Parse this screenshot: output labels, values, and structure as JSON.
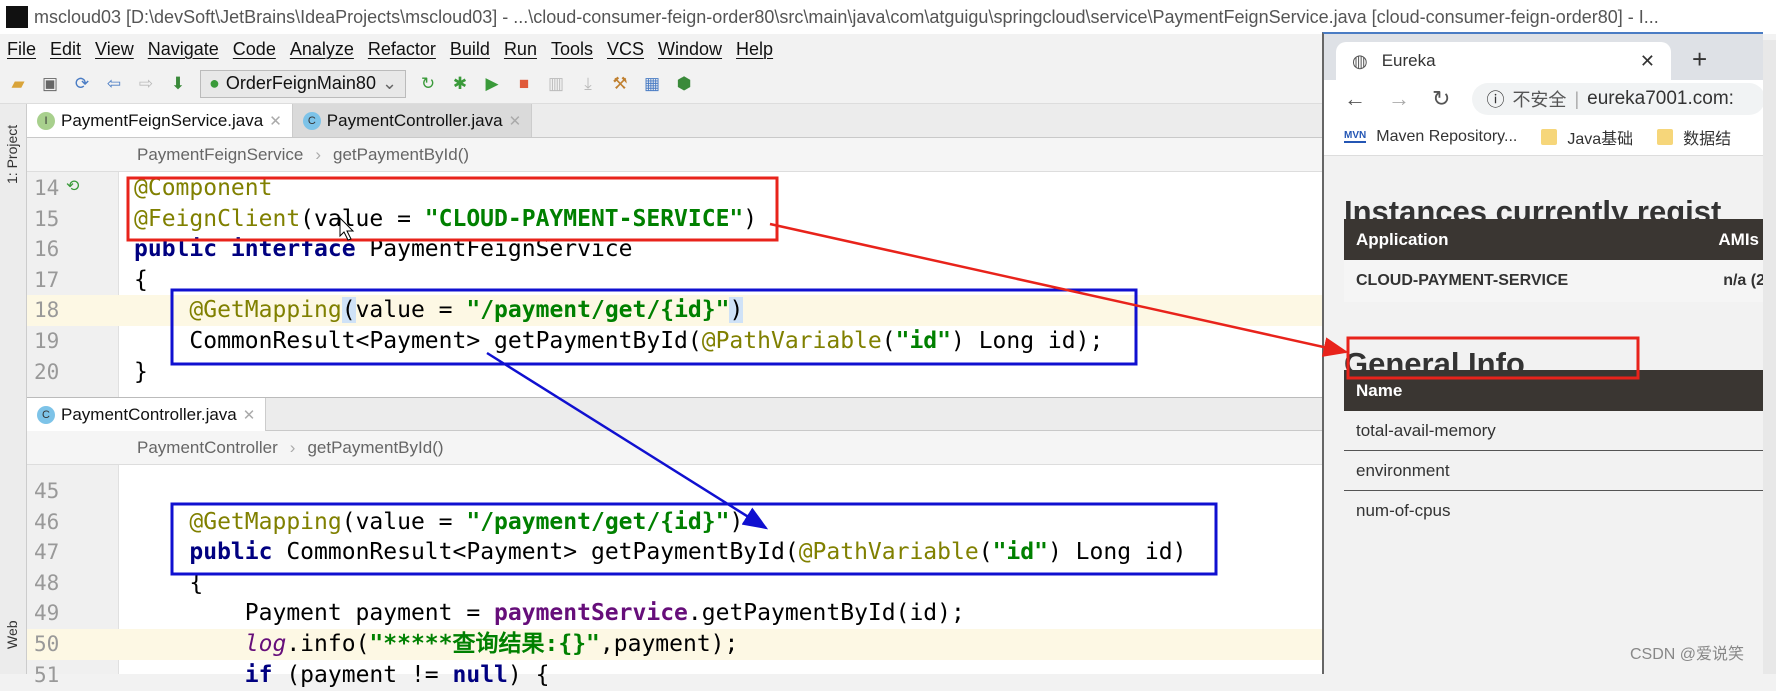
{
  "window": {
    "title": "mscloud03 [D:\\devSoft\\JetBrains\\IdeaProjects\\mscloud03] - ...\\cloud-consumer-feign-order80\\src\\main\\java\\com\\atguigu\\springcloud\\service\\PaymentFeignService.java [cloud-consumer-feign-order80] - I...",
    "app_icon": "IJ"
  },
  "menu": [
    "File",
    "Edit",
    "View",
    "Navigate",
    "Code",
    "Analyze",
    "Refactor",
    "Build",
    "Run",
    "Tools",
    "VCS",
    "Window",
    "Help"
  ],
  "toolbar": {
    "run_config": "OrderFeignMain80"
  },
  "side": {
    "project": "1: Project",
    "web": "Web"
  },
  "editor1": {
    "tabs": [
      {
        "label": "PaymentFeignService.java",
        "icon": "I",
        "color": "#a8d08d"
      },
      {
        "label": "PaymentController.java",
        "icon": "C",
        "color": "#7dc3e8"
      }
    ],
    "breadcrumb": [
      "PaymentFeignService",
      "getPaymentById()"
    ],
    "lines": [
      {
        "n": "14",
        "tokens": [
          [
            "@Component",
            "ann"
          ]
        ]
      },
      {
        "n": "15",
        "tokens": [
          [
            "@FeignClient",
            "ann"
          ],
          [
            "(value = ",
            ""
          ],
          [
            "\"CLOUD-PAYMENT-SERVICE\"",
            "str"
          ],
          [
            ")",
            ""
          ]
        ]
      },
      {
        "n": "16",
        "tokens": [
          [
            "public interface",
            "kw"
          ],
          [
            " PaymentFeignService",
            ""
          ]
        ]
      },
      {
        "n": "17",
        "tokens": [
          [
            "{",
            ""
          ]
        ]
      },
      {
        "n": "18",
        "tokens": [
          [
            "    ",
            ""
          ],
          [
            "@GetMapping",
            "ann"
          ],
          [
            "(",
            "brk"
          ],
          [
            "value = ",
            ""
          ],
          [
            "\"/payment/get/{id}\"",
            "str"
          ],
          [
            ")",
            "brk"
          ]
        ]
      },
      {
        "n": "19",
        "tokens": [
          [
            "    CommonResult<Payment> getPaymentById(",
            ""
          ],
          [
            "@PathVariable",
            "ann"
          ],
          [
            "(",
            ""
          ],
          [
            "\"id\"",
            "str"
          ],
          [
            ") Long id);",
            ""
          ]
        ]
      },
      {
        "n": "20",
        "tokens": [
          [
            "}",
            ""
          ]
        ]
      }
    ]
  },
  "editor2": {
    "tab": {
      "label": "PaymentController.java",
      "icon": "C",
      "color": "#7dc3e8"
    },
    "breadcrumb": [
      "PaymentController",
      "getPaymentById()"
    ],
    "lines": [
      {
        "n": "45",
        "tokens": []
      },
      {
        "n": "46",
        "tokens": [
          [
            "    ",
            ""
          ],
          [
            "@GetMapping",
            "ann"
          ],
          [
            "(value = ",
            ""
          ],
          [
            "\"/payment/get/{id}\"",
            "str"
          ],
          [
            ")",
            ""
          ]
        ]
      },
      {
        "n": "47",
        "tokens": [
          [
            "    ",
            ""
          ],
          [
            "public",
            "kw"
          ],
          [
            " CommonResult<Payment> getPaymentById(",
            ""
          ],
          [
            "@PathVariable",
            "ann"
          ],
          [
            "(",
            ""
          ],
          [
            "\"id\"",
            "str"
          ],
          [
            ") Long id)",
            ""
          ]
        ]
      },
      {
        "n": "48",
        "tokens": [
          [
            "    {",
            ""
          ]
        ]
      },
      {
        "n": "49",
        "tokens": [
          [
            "        Payment payment = ",
            ""
          ],
          [
            "paymentService",
            "fld"
          ],
          [
            ".getPaymentById(id);",
            ""
          ]
        ]
      },
      {
        "n": "50",
        "tokens": [
          [
            "        ",
            ""
          ],
          [
            "log",
            "it"
          ],
          [
            ".info(",
            ""
          ],
          [
            "\"*****查询结果:{}\"",
            "str"
          ],
          [
            ",payment);",
            ""
          ]
        ]
      },
      {
        "n": "51",
        "tokens": [
          [
            "        ",
            ""
          ],
          [
            "if",
            "kw"
          ],
          [
            " (payment != ",
            ""
          ],
          [
            "null",
            "kw"
          ],
          [
            ") {",
            ""
          ]
        ]
      }
    ]
  },
  "browser": {
    "tab_title": "Eureka",
    "url_warning": "不安全",
    "url": "eureka7001.com:",
    "bookmarks": [
      "Maven Repository...",
      "Java基础",
      "数据结"
    ],
    "heading1": "Instances currently regist",
    "app_header": "Application",
    "amis_header": "AMIs",
    "app_name": "CLOUD-PAYMENT-SERVICE",
    "amis": "n/a (2",
    "heading2": "General Info",
    "name_header": "Name",
    "rows": [
      "total-avail-memory",
      "environment",
      "num-of-cpus"
    ]
  },
  "watermark": "CSDN @爱说笑",
  "annotation_colors": {
    "red": "#e8231b",
    "blue": "#1010d0"
  }
}
